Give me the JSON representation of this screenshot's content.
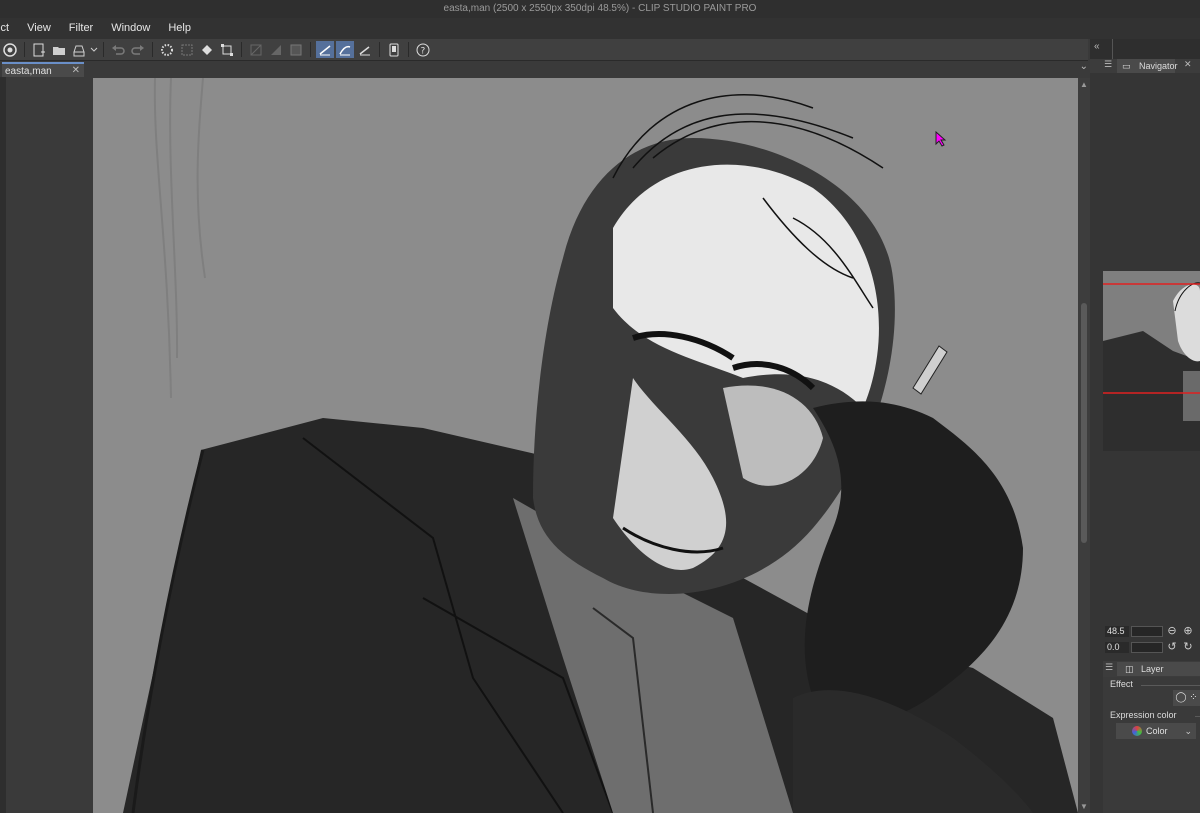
{
  "window": {
    "title": "easta,man (2500 x 2550px 350dpi 48.5%)  - CLIP STUDIO PAINT PRO"
  },
  "menu": {
    "items": [
      "lect",
      "View",
      "Filter",
      "Window",
      "Help"
    ]
  },
  "toolbar": {
    "icons": [
      "clip-studio-icon",
      "new-document-icon",
      "open-icon",
      "save-icon",
      "dropdown-icon",
      "undo-icon",
      "redo-icon",
      "loading-icon",
      "clear-icon",
      "fill-icon",
      "transform-icon",
      "hide-selection-icon",
      "crop-icon",
      "invert-icon",
      "snap-ruler-icon",
      "snap-special-ruler-icon",
      "snap-grid-icon",
      "device-icon",
      "help-icon"
    ]
  },
  "tabs": {
    "document_tab": "easta,man",
    "close_label": "✕"
  },
  "right_panel": {
    "navigator_tab": "Navigator",
    "zoom_value": "48.5",
    "rotation_value": "0.0",
    "layer_property_tab": "Layer Property",
    "effect_label": "Effect",
    "expression_color_label": "Expression color",
    "expression_color_value": "Color"
  },
  "colors": {
    "canvas_bg": "#8c8c8c",
    "accent": "#55709b",
    "panel_bg": "#353535",
    "nav_frame": "#e02020"
  }
}
